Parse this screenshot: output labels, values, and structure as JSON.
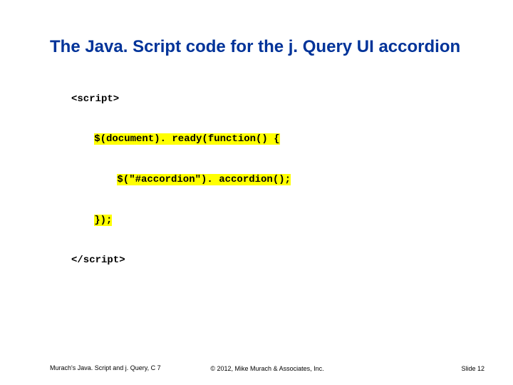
{
  "title": "The Java. Script code for the j. Query UI accordion",
  "code": {
    "l1": "<script>",
    "l2": "$(document). ready(function() {",
    "l3": "$(\"#accordion\"). accordion();",
    "l4": "});",
    "l5_close": "</script>"
  },
  "footer": {
    "left": "Murach's Java. Script and j. Query, C 7",
    "center": "© 2012, Mike Murach & Associates, Inc.",
    "right": "Slide 12"
  }
}
